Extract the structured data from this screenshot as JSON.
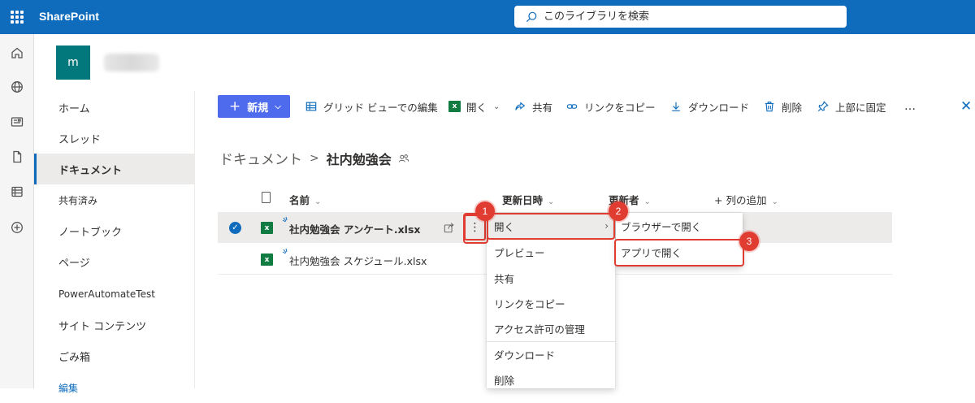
{
  "app": {
    "title": "SharePoint"
  },
  "search": {
    "placeholder": "このライブラリを検索"
  },
  "site": {
    "logo_letter": "m"
  },
  "left_nav": {
    "items": [
      {
        "label": "ホーム"
      },
      {
        "label": "スレッド"
      },
      {
        "label": "ドキュメント"
      },
      {
        "label": "共有済み"
      },
      {
        "label": "ノートブック"
      },
      {
        "label": "ページ"
      },
      {
        "label": "PowerAutomateTest"
      },
      {
        "label": "サイト コンテンツ"
      },
      {
        "label": "ごみ箱"
      },
      {
        "label": "編集"
      }
    ]
  },
  "commands": {
    "new": "新規",
    "grid_edit": "グリッド ビューでの編集",
    "open": "開く",
    "share": "共有",
    "copy_link": "リンクをコピー",
    "download": "ダウンロード",
    "delete": "削除",
    "pin_top": "上部に固定",
    "more": "…",
    "close": "✕"
  },
  "breadcrumb": {
    "root": "ドキュメント",
    "separator": ">",
    "current": "社内勉強会"
  },
  "list": {
    "columns": {
      "name": "名前",
      "modified": "更新日時",
      "modified_by": "更新者",
      "add_column": "+ 列の追加"
    },
    "rows": [
      {
        "name": "社内勉強会 アンケート.xlsx",
        "selected": true
      },
      {
        "name": "社内勉強会 スケジュール.xlsx",
        "selected": false
      }
    ]
  },
  "context_menu": {
    "items": [
      {
        "label": "開く"
      },
      {
        "label": "プレビュー"
      },
      {
        "label": "共有"
      },
      {
        "label": "リンクをコピー"
      },
      {
        "label": "アクセス許可の管理"
      },
      {
        "label": "ダウンロード"
      },
      {
        "label": "削除"
      }
    ]
  },
  "submenu": {
    "items": [
      {
        "label": "ブラウザーで開く"
      },
      {
        "label": "アプリで開く"
      }
    ]
  },
  "annotations": {
    "step1": "1",
    "step2": "2",
    "step3": "3"
  },
  "colors": {
    "brand": "#0f6cbd",
    "new_button": "#4f6bed",
    "excel": "#107c41",
    "highlight": "#e03c31",
    "site_logo": "#03787c"
  }
}
